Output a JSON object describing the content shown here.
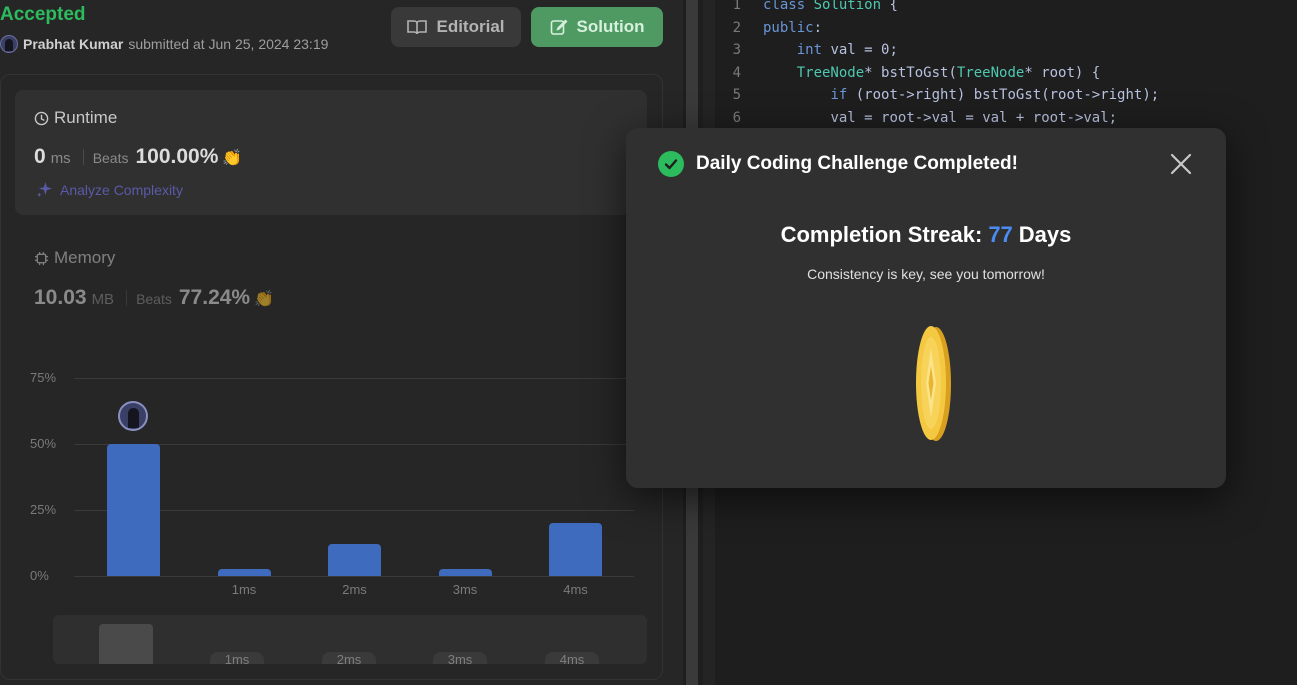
{
  "submission": {
    "status": "Accepted",
    "user_name": "Prabhat Kumar",
    "submitted_text": "submitted at Jun 25, 2024 23:19"
  },
  "buttons": {
    "editorial": "Editorial",
    "solution": "Solution"
  },
  "runtime": {
    "label": "Runtime",
    "value": "0",
    "unit": "ms",
    "beats_label": "Beats",
    "beats_pct": "100.00%",
    "analyze": "Analyze Complexity"
  },
  "memory": {
    "label": "Memory",
    "value": "10.03",
    "unit": "MB",
    "beats_label": "Beats",
    "beats_pct": "77.24%"
  },
  "chart_data": {
    "type": "bar",
    "y_tick_labels": [
      "75%",
      "50%",
      "25%",
      "0%"
    ],
    "ylim": [
      0,
      75
    ],
    "x_tick_labels": [
      "",
      "1ms",
      "2ms",
      "3ms",
      "4ms"
    ],
    "values": [
      50,
      2.5,
      12,
      2.5,
      20
    ],
    "highlight_index": 0,
    "bar_color": "#3f6bbf"
  },
  "mini_chart": {
    "ticks": [
      "1ms",
      "2ms",
      "3ms",
      "4ms"
    ]
  },
  "code": {
    "lines": [
      {
        "n": "1",
        "text": "class Solution {"
      },
      {
        "n": "2",
        "text": "public:"
      },
      {
        "n": "3",
        "text": "    int val = 0;"
      },
      {
        "n": "4",
        "text": "    TreeNode* bstToGst(TreeNode* root) {"
      },
      {
        "n": "5",
        "text": "        if (root->right) bstToGst(root->right);"
      },
      {
        "n": "6",
        "text": "        val = root->val = val + root->val;"
      }
    ]
  },
  "modal": {
    "title": "Daily Coding Challenge Completed!",
    "streak_label": "Completion Streak:",
    "streak_value": "77",
    "streak_unit": "Days",
    "message": "Consistency is key, see you tomorrow!",
    "accent_color": "#4a8cf2",
    "success_color": "#2cbb5d"
  }
}
